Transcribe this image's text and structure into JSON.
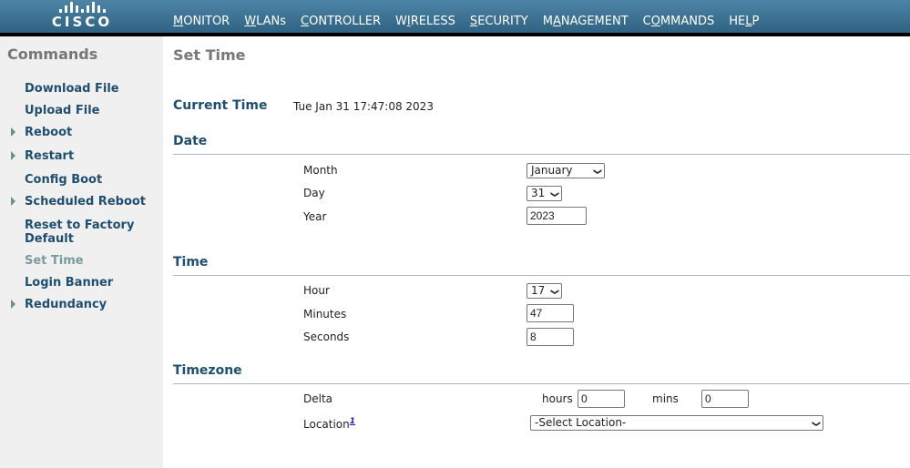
{
  "brand": {
    "logo_text": "CISCO"
  },
  "nav": {
    "items": [
      {
        "label": "MONITOR",
        "accesskey": "M"
      },
      {
        "label": "WLANs",
        "accesskey": "W"
      },
      {
        "label": "CONTROLLER",
        "accesskey": "C"
      },
      {
        "label": "WIRELESS",
        "accesskey": "I"
      },
      {
        "label": "SECURITY",
        "accesskey": "S"
      },
      {
        "label": "MANAGEMENT",
        "accesskey": "A"
      },
      {
        "label": "COMMANDS",
        "accesskey": "O",
        "active": true
      },
      {
        "label": "HELP",
        "accesskey": "L"
      }
    ]
  },
  "sidebar": {
    "title": "Commands",
    "items": [
      {
        "label": "Download File",
        "expandable": false
      },
      {
        "label": "Upload File",
        "expandable": false
      },
      {
        "label": "Reboot",
        "expandable": true
      },
      {
        "label": "Restart",
        "expandable": true
      },
      {
        "label": "Config Boot",
        "expandable": false
      },
      {
        "label": "Scheduled Reboot",
        "expandable": true
      },
      {
        "label": "Reset to Factory Default",
        "label_line1": "Reset to Factory",
        "label_line2": "Default",
        "expandable": false
      },
      {
        "label": "Set Time",
        "expandable": false,
        "current": true
      },
      {
        "label": "Login Banner",
        "expandable": false
      },
      {
        "label": "Redundancy",
        "expandable": true
      }
    ]
  },
  "main": {
    "title": "Set Time",
    "current_time_label": "Current Time",
    "current_time_value": "Tue Jan 31 17:47:08 2023",
    "date": {
      "heading": "Date",
      "month_label": "Month",
      "month_value": "January",
      "day_label": "Day",
      "day_value": "31",
      "year_label": "Year",
      "year_value": "2023"
    },
    "time": {
      "heading": "Time",
      "hour_label": "Hour",
      "hour_value": "17",
      "minutes_label": "Minutes",
      "minutes_value": "47",
      "seconds_label": "Seconds",
      "seconds_value": "8"
    },
    "timezone": {
      "heading": "Timezone",
      "delta_label": "Delta",
      "hours_label": "hours",
      "hours_value": "0",
      "mins_label": "mins",
      "mins_value": "0",
      "location_label": "Location",
      "location_footnote": "1",
      "location_value": "-Select Location-"
    }
  }
}
